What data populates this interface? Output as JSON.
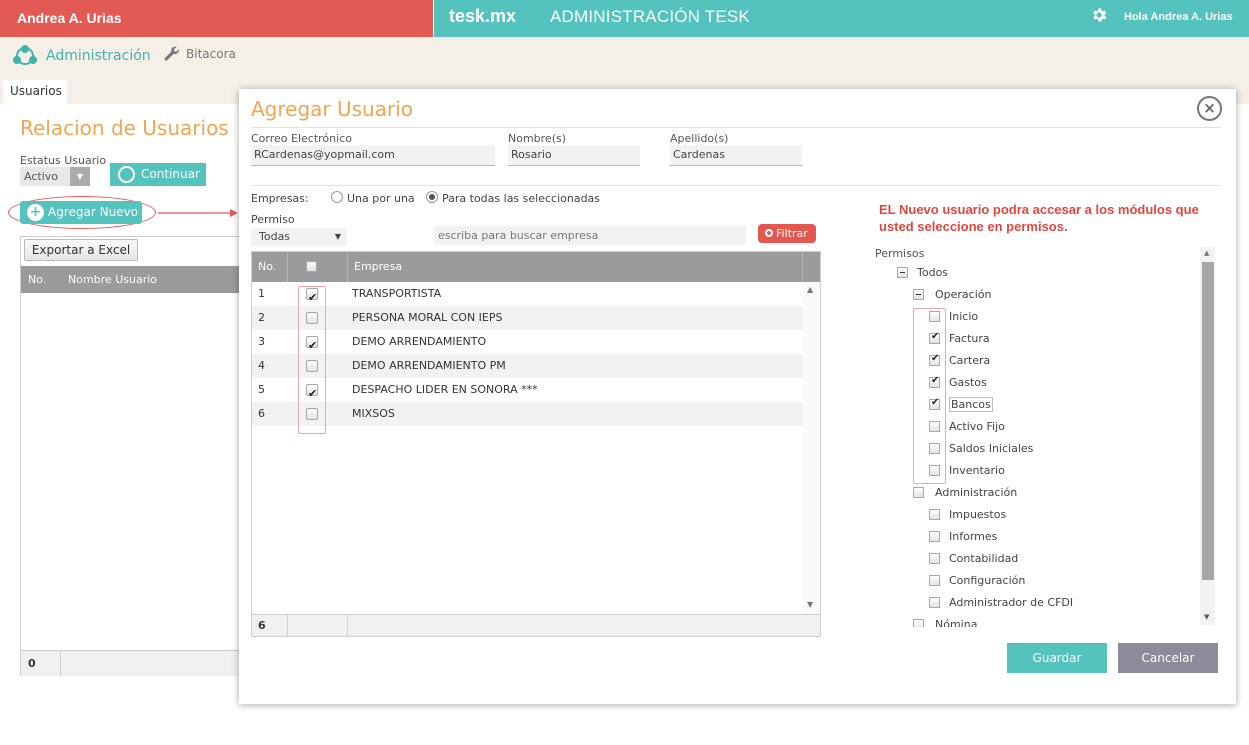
{
  "topbar": {
    "user": "Andrea A. Urias",
    "brand": "tesk.mx",
    "title": "ADMINISTRACIÓN TESK",
    "greeting": "Hola Andrea A. Urias"
  },
  "nav": {
    "admin": "Administración",
    "bitacora": "Bitacora"
  },
  "bg": {
    "tab": "Usuarios",
    "title": "Relacion de Usuarios",
    "status_label": "Estatus Usuario",
    "status_value": "Activo",
    "continue": "Continuar",
    "add_new": "Agregar Nuevo",
    "export": "Exportar a Excel",
    "col_no": "No.",
    "col_name": "Nombre Usuario",
    "footer_count": "0"
  },
  "modal": {
    "title": "Agregar Usuario",
    "email_label": "Correo Electrónico",
    "email_value": "RCardenas@yopmail.com",
    "name_label": "Nombre(s)",
    "name_value": "Rosario",
    "last_label": "Apellido(s)",
    "last_value": "Cardenas",
    "companies_label": "Empresas:",
    "radio_one": "Una por una",
    "radio_all": "Para todas las seleccionadas",
    "permission_label": "Permiso",
    "permission_value": "Todas",
    "search_placeholder": "escriba para buscar empresa",
    "filter": "Filtrar",
    "note": "EL Nuevo usuario podra accesar a los módulos que usted seleccione en permisos.",
    "save": "Guardar",
    "cancel": "Cancelar"
  },
  "grid": {
    "col_no": "No.",
    "col_company": "Empresa",
    "rows": [
      {
        "no": "1",
        "name": "TRANSPORTISTA",
        "checked": true
      },
      {
        "no": "2",
        "name": "PERSONA MORAL CON IEPS",
        "checked": false
      },
      {
        "no": "3",
        "name": "DEMO ARRENDAMIENTO",
        "checked": true
      },
      {
        "no": "4",
        "name": "DEMO ARRENDAMIENTO PM",
        "checked": false
      },
      {
        "no": "5",
        "name": "DESPACHO LIDER EN SONORA ***",
        "checked": true
      },
      {
        "no": "6",
        "name": "MIXSOS",
        "checked": false
      }
    ],
    "footer_count": "6"
  },
  "permissions": {
    "title": "Permisos",
    "nodes": [
      {
        "label": "Todos",
        "level": 0,
        "state": "minus"
      },
      {
        "label": "Operación",
        "level": 1,
        "state": "minus"
      },
      {
        "label": "Inicio",
        "level": 2,
        "state": "off"
      },
      {
        "label": "Factura",
        "level": 2,
        "state": "on"
      },
      {
        "label": "Cartera",
        "level": 2,
        "state": "on"
      },
      {
        "label": "Gastos",
        "level": 2,
        "state": "on"
      },
      {
        "label": "Bancos",
        "level": 2,
        "state": "on"
      },
      {
        "label": "Activo Fijo",
        "level": 2,
        "state": "off"
      },
      {
        "label": "Saldos Iniciales",
        "level": 2,
        "state": "off"
      },
      {
        "label": "Inventario",
        "level": 2,
        "state": "off"
      },
      {
        "label": "Administración",
        "level": 1,
        "state": "off"
      },
      {
        "label": "Impuestos",
        "level": 2,
        "state": "off"
      },
      {
        "label": "Informes",
        "level": 2,
        "state": "off"
      },
      {
        "label": "Contabilidad",
        "level": 2,
        "state": "off"
      },
      {
        "label": "Configuración",
        "level": 2,
        "state": "off"
      },
      {
        "label": "Administrador de CFDI",
        "level": 2,
        "state": "off"
      },
      {
        "label": "Nómina",
        "level": 1,
        "state": "off"
      }
    ]
  },
  "colors": {
    "teal": "#55c3bd",
    "red": "#e25a54",
    "orange": "#f0a552",
    "grey_header": "#9b9b9b"
  }
}
